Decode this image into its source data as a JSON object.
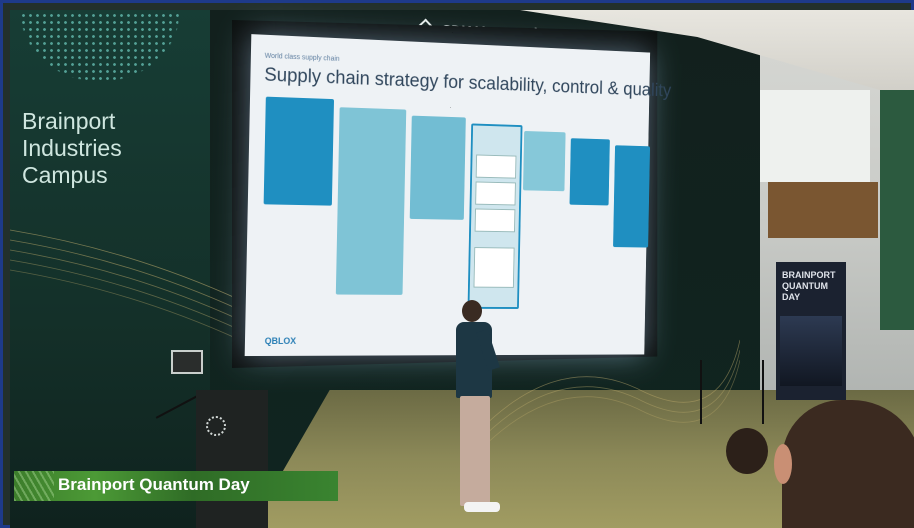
{
  "scene": {
    "venue_sign": "Brainport Industries Campus",
    "venue_lines": [
      "Brainport",
      "Industries",
      "Campus"
    ],
    "screen_header": "SDK Vastgoed"
  },
  "slide": {
    "breadcrumb": "World class supply chain",
    "title": "Supply chain strategy for scalability, control & quality",
    "footer_logo": "QBLOX"
  },
  "side_poster": {
    "title_lines": [
      "BRAINPORT",
      "QUANTUM",
      "DAY"
    ]
  },
  "lower_third": {
    "caption": "Brainport Quantum Day"
  },
  "colors": {
    "lower_third_green": "#3c7d2b",
    "slide_accent_blue": "#1f8fc1",
    "frame_border": "#1e3a8a"
  }
}
